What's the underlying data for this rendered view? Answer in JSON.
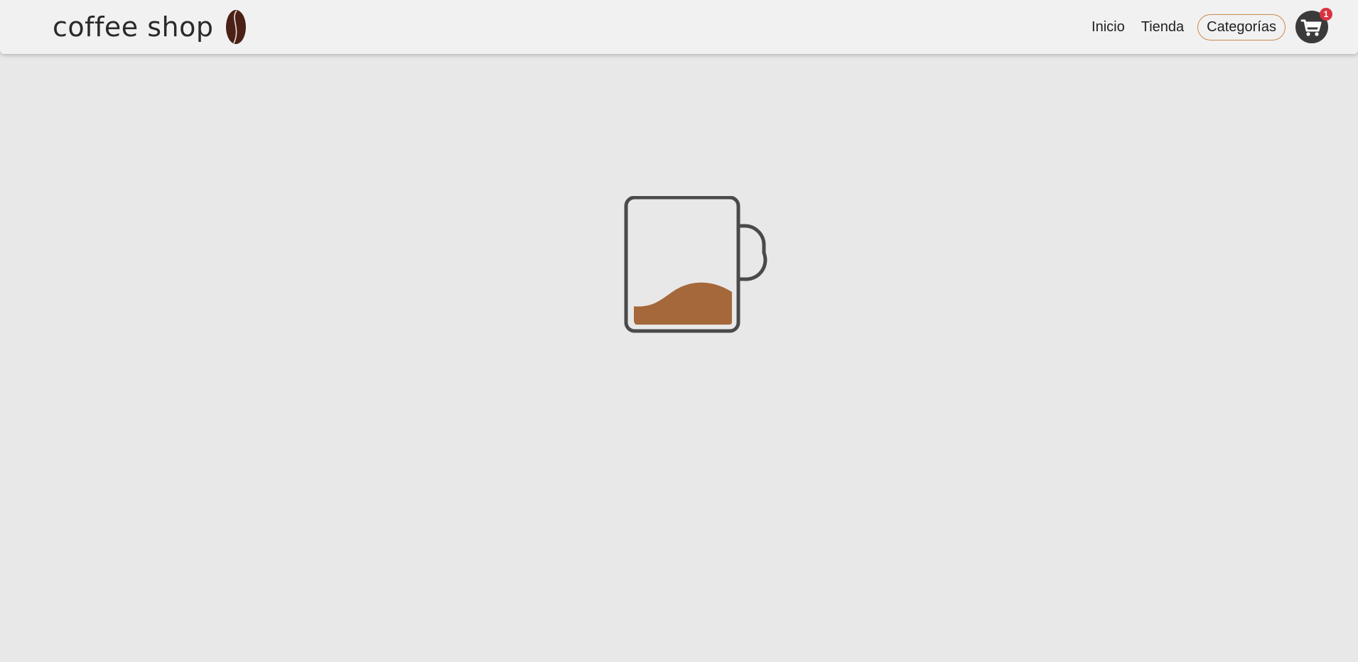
{
  "brand": {
    "name": "coffee shop",
    "logo_icon": "coffee-bean-icon"
  },
  "nav": {
    "items": [
      {
        "label": "Inicio",
        "active": false
      },
      {
        "label": "Tienda",
        "active": false
      },
      {
        "label": "Categorías",
        "active": true
      }
    ],
    "cart": {
      "icon": "cart-icon",
      "count": "1"
    }
  },
  "loader": {
    "icon": "coffee-mug-loading-icon",
    "fill_level": 0.38
  },
  "colors": {
    "background": "#e8e8e8",
    "navbar": "#f1f1f1",
    "accent_border": "#c9894f",
    "coffee": "#a5683a",
    "mug_outline": "#4a4a4a",
    "bean": "#4b2016",
    "badge": "#d8343f"
  }
}
